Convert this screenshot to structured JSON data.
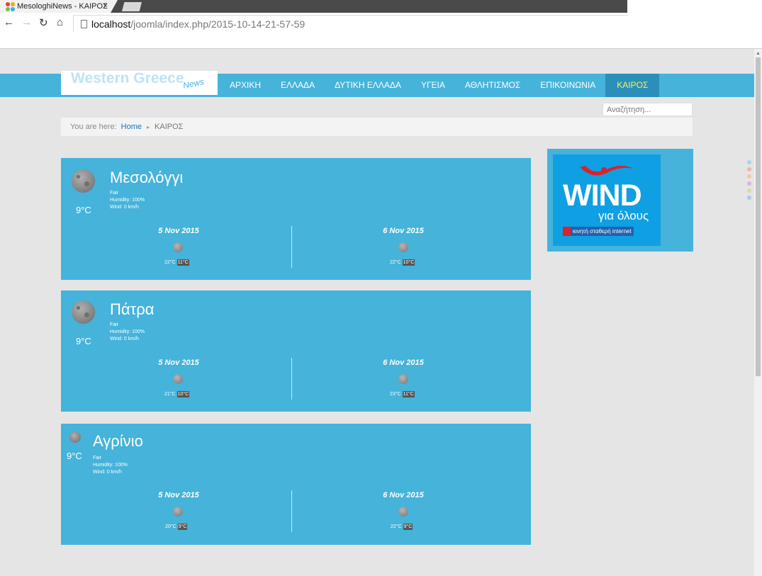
{
  "browser": {
    "tab_title": "MesologhiNews - ΚΑΙΡΟΣ",
    "tab_close": "×",
    "url_host": "localhost",
    "url_path": "/joomla/index.php/2015-10-14-21-57-59"
  },
  "header": {
    "logo_text": "Western Greece",
    "logo_sub": "News",
    "menu": [
      "ΑΡΧΙΚΗ",
      "ΕΛΛΑΔΑ",
      "ΔΥΤΙΚΗ ΕΛΛΑΔΑ",
      "ΥΓΕΙΑ",
      "ΑΘΛΗΤΙΣΜΟΣ",
      "ΕΠΙΚΟΙΝΩΝΙΑ",
      "ΚΑΙΡΟΣ"
    ],
    "active_menu": "ΚΑΙΡΟΣ",
    "search_placeholder": "Αναζήτηση..."
  },
  "breadcrumb": {
    "label": "You are here:",
    "home": "Home",
    "separator": "▸",
    "current": "ΚΑΙΡΟΣ"
  },
  "weather": [
    {
      "city": "Μεσολόγγι",
      "current_temp": "9°C",
      "condition": "Fair",
      "humidity": "Humidity: 100%",
      "wind": "Wind: 0 km/h",
      "forecast": [
        {
          "date": "5 Nov 2015",
          "high": "22°C",
          "low": "11°C"
        },
        {
          "date": "6 Nov 2015",
          "high": "22°C",
          "low": "10°C"
        }
      ]
    },
    {
      "city": "Πάτρα",
      "current_temp": "9°C",
      "condition": "Fair",
      "humidity": "Humidity: 100%",
      "wind": "Wind: 0 km/h",
      "forecast": [
        {
          "date": "5 Nov 2015",
          "high": "21°C",
          "low": "10°C"
        },
        {
          "date": "6 Nov 2015",
          "high": "23°C",
          "low": "11°C"
        }
      ]
    },
    {
      "city": "Αγρίνιο",
      "current_temp": "9°C",
      "condition": "Fair",
      "humidity": "Humidity: 100%",
      "wind": "Wind: 0 km/h",
      "forecast": [
        {
          "date": "5 Nov 2015",
          "high": "20°C",
          "low": "9°C"
        },
        {
          "date": "6 Nov 2015",
          "high": "22°C",
          "low": "9°C"
        }
      ]
    }
  ],
  "ad": {
    "brand": "WIND",
    "tagline": "για όλους",
    "strip": "κινητή σταθερή internet"
  },
  "colors": {
    "accent": "#45b3da",
    "active_menu_bg": "#2c8fba",
    "active_menu_text": "#f8f15a",
    "background": "#e5e5e5"
  }
}
